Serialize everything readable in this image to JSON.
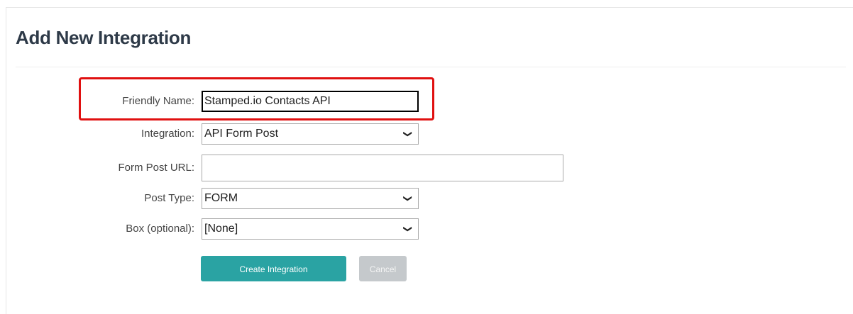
{
  "page": {
    "title": "Add New Integration"
  },
  "form": {
    "friendly_name": {
      "label": "Friendly Name:",
      "value": "Stamped.io Contacts API"
    },
    "integration": {
      "label": "Integration:",
      "value": "API Form Post"
    },
    "form_post_url": {
      "label": "Form Post URL:",
      "value": ""
    },
    "post_type": {
      "label": "Post Type:",
      "value": "FORM"
    },
    "box": {
      "label": "Box (optional):",
      "value": "[None]"
    }
  },
  "actions": {
    "create_label": "Create Integration",
    "cancel_label": "Cancel"
  },
  "icons": {
    "dropdown": "chevron-down-icon"
  },
  "colors": {
    "primary": "#2aa3a3",
    "cancel": "#c5c9cc",
    "highlight": "#e01010"
  }
}
